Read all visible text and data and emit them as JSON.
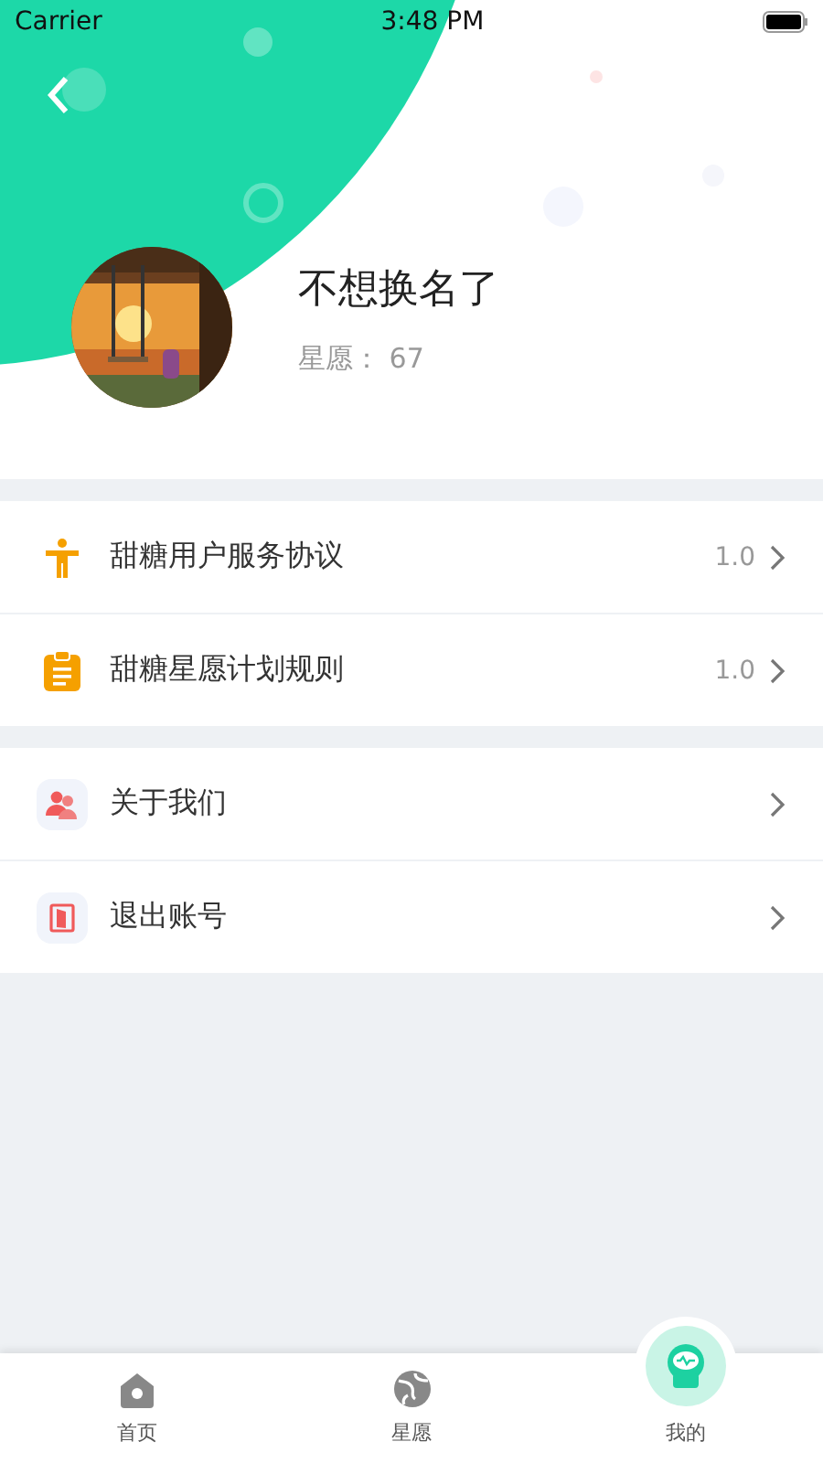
{
  "status_bar": {
    "carrier": "Carrier",
    "time": "3:48 PM"
  },
  "profile": {
    "name": "不想换名了",
    "stars_label": "星愿：",
    "stars_value": "67"
  },
  "menu_groups": [
    {
      "items": [
        {
          "kind": "person",
          "label": "甜糖用户服务协议",
          "version": "1.0"
        },
        {
          "kind": "clipboard",
          "label": "甜糖星愿计划规则",
          "version": "1.0"
        }
      ]
    },
    {
      "items": [
        {
          "kind": "people",
          "label": "关于我们"
        },
        {
          "kind": "door",
          "label": "退出账号"
        }
      ]
    }
  ],
  "tabs": [
    {
      "kind": "home",
      "label": "首页",
      "selected": false
    },
    {
      "kind": "globe",
      "label": "星愿",
      "selected": false
    },
    {
      "kind": "robot",
      "label": "我的",
      "selected": true
    }
  ]
}
